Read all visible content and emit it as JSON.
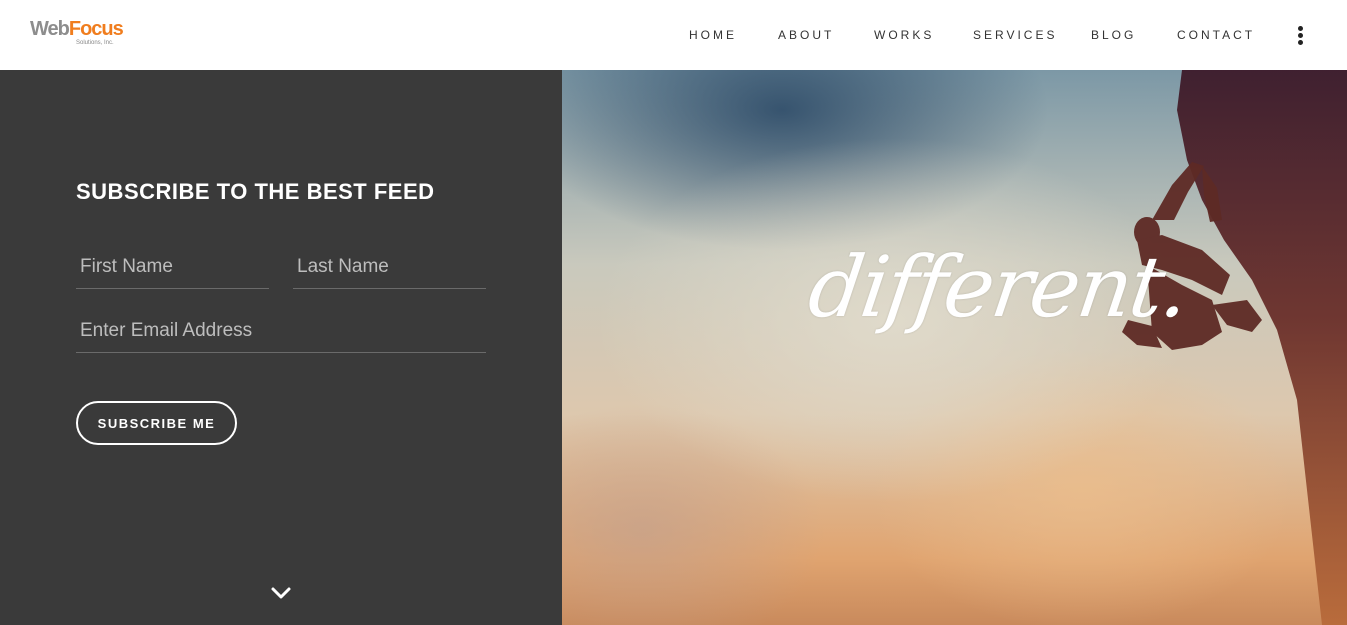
{
  "header": {
    "logo": {
      "brand_part1": "Web",
      "brand_part2": "Focus",
      "tagline": "Solutions, Inc."
    },
    "nav": {
      "items": [
        {
          "label": "HOME"
        },
        {
          "label": "ABOUT"
        },
        {
          "label": "WORKS"
        },
        {
          "label": "SERVICES"
        },
        {
          "label": "BLOG"
        },
        {
          "label": "CONTACT"
        }
      ],
      "menu_icon": "kebab-menu-icon"
    }
  },
  "subscribe": {
    "title": "SUBSCRIBE TO THE BEST FEED",
    "first_name_placeholder": "First Name",
    "last_name_placeholder": "Last Name",
    "email_placeholder": "Enter Email Address",
    "button_label": "SUBSCRIBE ME",
    "scroll_icon": "chevron-down-icon"
  },
  "hero": {
    "word": "different."
  },
  "colors": {
    "panel_bg": "#3a3a3a",
    "accent_orange": "#f07d1e",
    "logo_gray": "#8d8d8d"
  }
}
